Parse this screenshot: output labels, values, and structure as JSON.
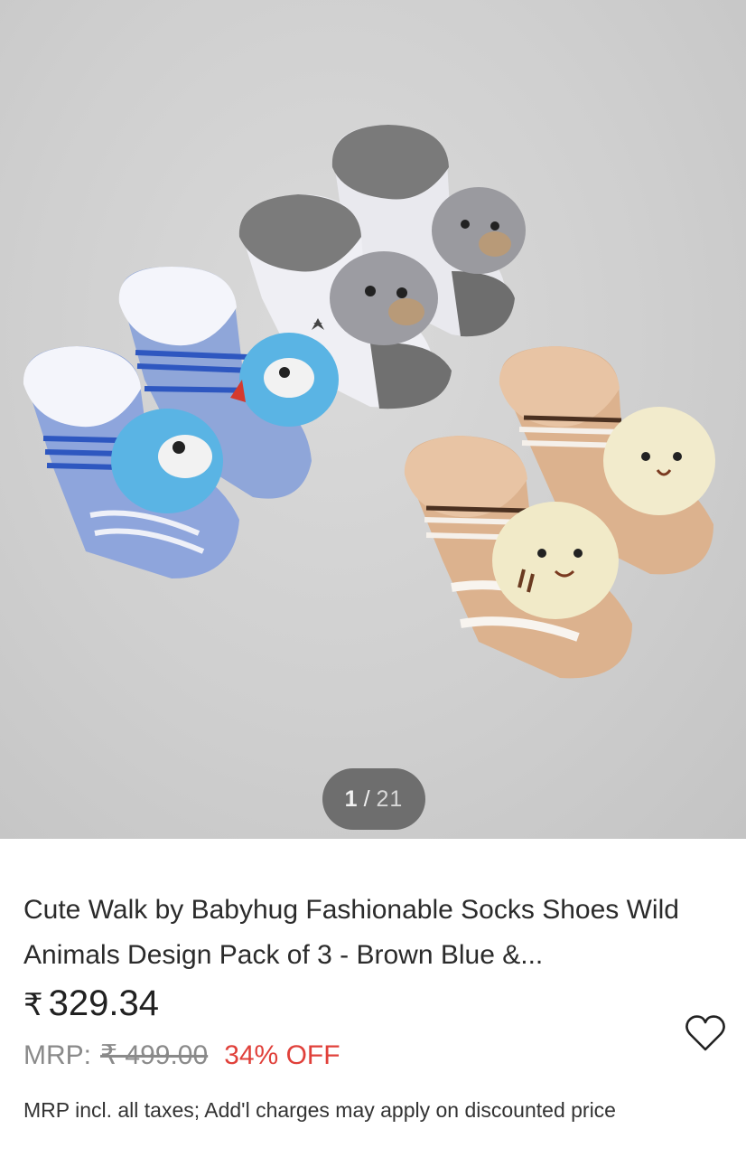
{
  "gallery": {
    "current": "1",
    "separator": "/",
    "total": "21"
  },
  "product": {
    "title": "Cute Walk by Babyhug Fashionable Socks Shoes Wild Animals Design Pack of 3 - Brown Blue &...",
    "currency": "₹",
    "price": "329.34",
    "mrp_label": "MRP:",
    "mrp_value": "₹ 499.00",
    "discount": "34% OFF",
    "tax_note": "MRP incl. all taxes; Add'l charges may apply on discounted price"
  },
  "icons": {
    "wishlist": "heart-outline-icon"
  },
  "colors": {
    "discount": "#e0403a",
    "counter_bg": "#6e6e6e"
  }
}
